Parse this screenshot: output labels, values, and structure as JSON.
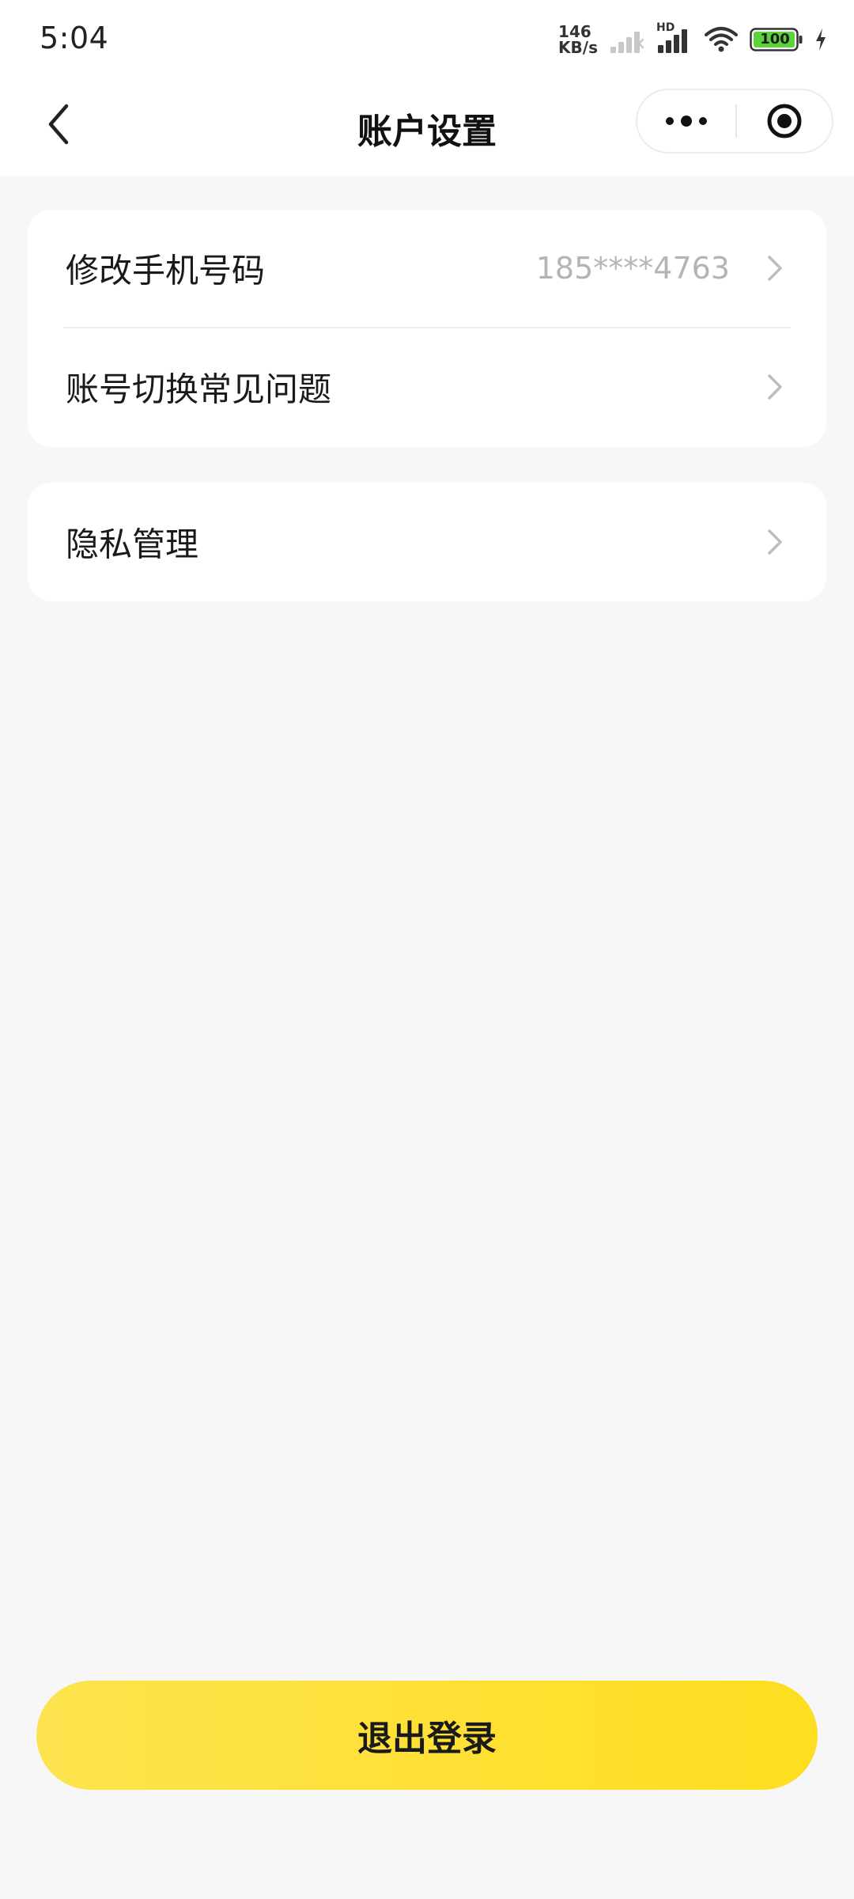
{
  "status_bar": {
    "time": "5:04",
    "net_speed_value": "146",
    "net_speed_unit": "KB/s",
    "hd_label": "HD",
    "battery_level": "100",
    "battery_color": "#5bd33a"
  },
  "nav": {
    "title": "账户设置",
    "back_icon": "chevron-left-icon",
    "more_icon": "more-dots-icon",
    "close_icon": "target-circle-icon"
  },
  "settings": {
    "group1": [
      {
        "label": "修改手机号码",
        "value": "185****4763"
      },
      {
        "label": "账号切换常见问题",
        "value": ""
      }
    ],
    "group2": [
      {
        "label": "隐私管理",
        "value": ""
      }
    ]
  },
  "actions": {
    "logout_label": "退出登录",
    "logout_color": "#fede1f"
  },
  "colors": {
    "background": "#f7f7f7",
    "card": "#ffffff",
    "muted_text": "#b4b4b4"
  }
}
